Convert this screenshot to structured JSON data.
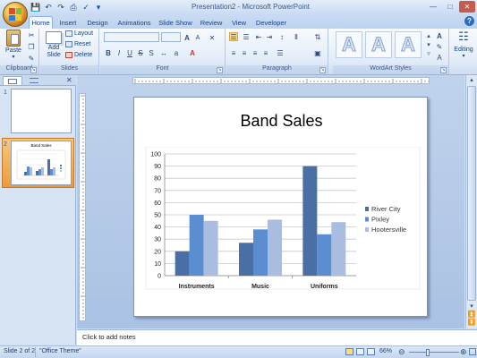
{
  "window": {
    "title": "Presentation2 - Microsoft PowerPoint"
  },
  "tabs": [
    "Home",
    "Insert",
    "Design",
    "Animations",
    "Slide Show",
    "Review",
    "View",
    "Developer"
  ],
  "ribbon": {
    "clipboard": {
      "label": "Clipboard",
      "paste": "Paste"
    },
    "slides": {
      "label": "Slides",
      "new_slide_line1": "Add",
      "new_slide_line2": "Slide",
      "layout": "Layout",
      "reset": "Reset",
      "delete": "Delete"
    },
    "font": {
      "label": "Font"
    },
    "paragraph": {
      "label": "Paragraph"
    },
    "wordart": {
      "label": "WordArt Styles",
      "letter": "A"
    },
    "editing": {
      "label": "Editing"
    }
  },
  "slides_pane": {
    "slide_numbers": [
      "1",
      "2"
    ],
    "thumb2_title": "Band Sales"
  },
  "slide": {
    "title": "Band Sales"
  },
  "chart_data": {
    "type": "bar",
    "title": "",
    "categories": [
      "Instruments",
      "Music",
      "Uniforms"
    ],
    "series": [
      {
        "name": "River City",
        "values": [
          20,
          27,
          90
        ],
        "color": "#4a6fa5"
      },
      {
        "name": "Pixley",
        "values": [
          50,
          38,
          34
        ],
        "color": "#5b8ed0"
      },
      {
        "name": "Hootersville",
        "values": [
          45,
          46,
          44
        ],
        "color": "#a9bde0"
      }
    ],
    "yticks": [
      "0",
      "10",
      "20",
      "30",
      "40",
      "50",
      "60",
      "70",
      "80",
      "90",
      "100"
    ],
    "ylim": [
      0,
      100
    ],
    "grid": true,
    "legend": "right"
  },
  "notes": {
    "placeholder": "Click to add notes"
  },
  "status": {
    "slide": "Slide 2 of 2",
    "theme": "\"Office Theme\"",
    "zoom": "66%"
  }
}
